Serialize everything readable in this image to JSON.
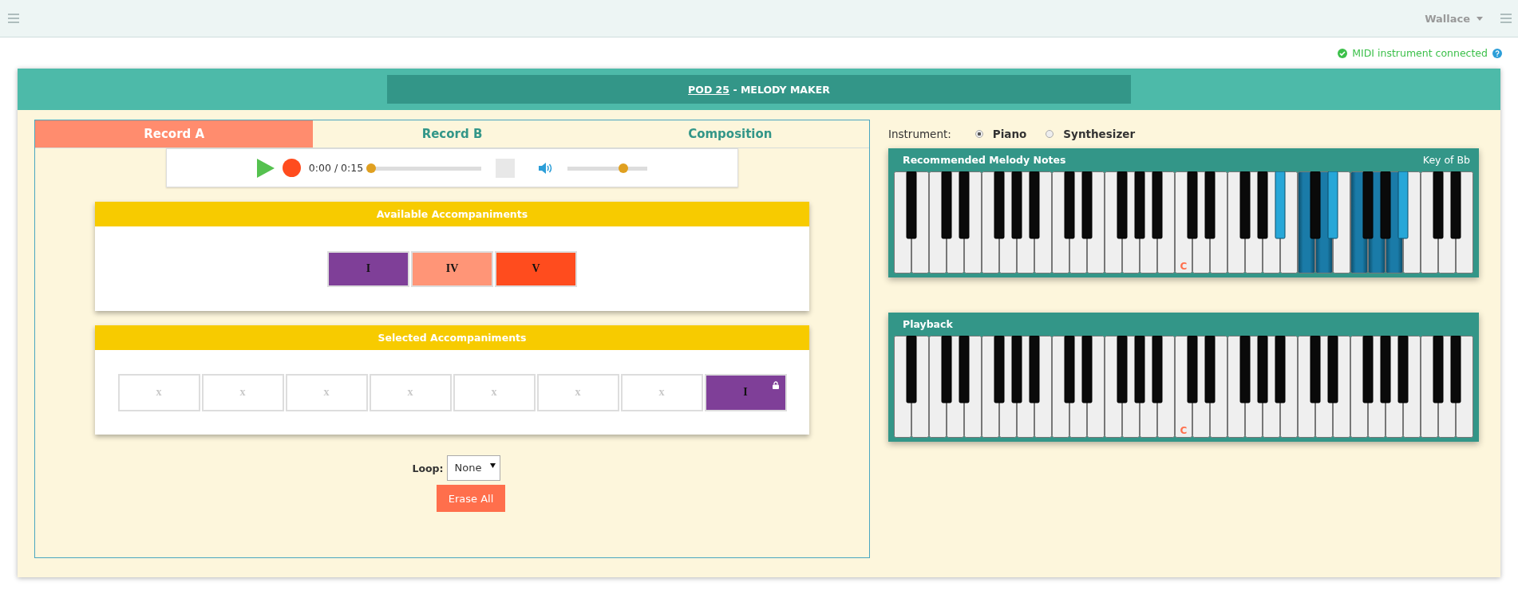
{
  "topbar": {
    "user": "Wallace"
  },
  "status": {
    "text": "MIDI instrument connected"
  },
  "header": {
    "link": "POD 25",
    "title": " - MELODY MAKER"
  },
  "tabs": [
    {
      "label": "Record A",
      "selected": true
    },
    {
      "label": "Record B",
      "selected": false
    },
    {
      "label": "Composition",
      "selected": false
    }
  ],
  "player": {
    "time": "0:00 / 0:15",
    "progress": {
      "level": 0
    },
    "volume": {
      "level": 0.72
    }
  },
  "available": {
    "title": "Available Accompaniments",
    "chords": [
      {
        "label": "I",
        "color": "#7f3f98"
      },
      {
        "label": "IV",
        "color": "#ff9577"
      },
      {
        "label": "V",
        "color": "#ff4c1e"
      }
    ]
  },
  "selected": {
    "title": "Selected Accompaniments",
    "slots": [
      {
        "kind": "empty",
        "label": "x"
      },
      {
        "kind": "empty",
        "label": "x"
      },
      {
        "kind": "empty",
        "label": "x"
      },
      {
        "kind": "empty",
        "label": "x"
      },
      {
        "kind": "empty",
        "label": "x"
      },
      {
        "kind": "empty",
        "label": "x"
      },
      {
        "kind": "empty",
        "label": "x"
      },
      {
        "kind": "chord",
        "label": "I",
        "color": "#7f3f98",
        "locked": true
      }
    ]
  },
  "loop": {
    "label": "Loop:",
    "value": "None"
  },
  "erase_button": "Erase All",
  "instrument": {
    "label": "Instrument:",
    "options": [
      {
        "label": "Piano",
        "selected": true
      },
      {
        "label": "Synthesizer",
        "selected": false
      }
    ]
  },
  "keyboards": [
    {
      "title": "Recommended Melody Notes",
      "key": "Key of Bb",
      "keys": [
        {
          "kind": "natural",
          "highlighted": false
        },
        {
          "kind": "sharp",
          "highlighted": false
        },
        {
          "kind": "natural",
          "highlighted": false
        },
        {
          "kind": "natural",
          "highlighted": false
        },
        {
          "kind": "sharp",
          "highlighted": false
        },
        {
          "kind": "natural",
          "highlighted": false
        },
        {
          "kind": "sharp",
          "highlighted": false
        },
        {
          "kind": "natural",
          "highlighted": false
        },
        {
          "kind": "natural",
          "highlighted": false
        },
        {
          "kind": "sharp",
          "highlighted": false
        },
        {
          "kind": "natural",
          "highlighted": false
        },
        {
          "kind": "sharp",
          "highlighted": false
        },
        {
          "kind": "natural",
          "highlighted": false
        },
        {
          "kind": "sharp",
          "highlighted": false
        },
        {
          "kind": "natural",
          "highlighted": false
        },
        {
          "kind": "natural",
          "highlighted": false
        },
        {
          "kind": "sharp",
          "highlighted": false
        },
        {
          "kind": "natural",
          "highlighted": false
        },
        {
          "kind": "sharp",
          "highlighted": false
        },
        {
          "kind": "natural",
          "highlighted": false
        },
        {
          "kind": "natural",
          "highlighted": false
        },
        {
          "kind": "sharp",
          "highlighted": false
        },
        {
          "kind": "natural",
          "highlighted": false
        },
        {
          "kind": "sharp",
          "highlighted": false
        },
        {
          "kind": "natural",
          "highlighted": false
        },
        {
          "kind": "sharp",
          "highlighted": false
        },
        {
          "kind": "natural",
          "highlighted": false
        },
        {
          "kind": "natural",
          "highlighted": false,
          "label": "C"
        },
        {
          "kind": "sharp",
          "highlighted": false
        },
        {
          "kind": "natural",
          "highlighted": false
        },
        {
          "kind": "sharp",
          "highlighted": false
        },
        {
          "kind": "natural",
          "highlighted": false
        },
        {
          "kind": "natural",
          "highlighted": false
        },
        {
          "kind": "sharp",
          "highlighted": false
        },
        {
          "kind": "natural",
          "highlighted": false
        },
        {
          "kind": "sharp",
          "highlighted": false
        },
        {
          "kind": "natural",
          "highlighted": false
        },
        {
          "kind": "sharp",
          "highlighted": true
        },
        {
          "kind": "natural",
          "highlighted": false
        },
        {
          "kind": "natural",
          "highlighted": true
        },
        {
          "kind": "sharp",
          "highlighted": false
        },
        {
          "kind": "natural",
          "highlighted": true
        },
        {
          "kind": "sharp",
          "highlighted": true
        },
        {
          "kind": "natural",
          "highlighted": false
        },
        {
          "kind": "natural",
          "highlighted": true
        },
        {
          "kind": "sharp",
          "highlighted": false
        },
        {
          "kind": "natural",
          "highlighted": true
        },
        {
          "kind": "sharp",
          "highlighted": false
        },
        {
          "kind": "natural",
          "highlighted": true
        },
        {
          "kind": "sharp",
          "highlighted": true
        },
        {
          "kind": "natural",
          "highlighted": false
        },
        {
          "kind": "natural",
          "highlighted": false
        },
        {
          "kind": "sharp",
          "highlighted": false
        },
        {
          "kind": "natural",
          "highlighted": false
        },
        {
          "kind": "sharp",
          "highlighted": false
        },
        {
          "kind": "natural",
          "highlighted": false
        }
      ]
    },
    {
      "title": "Playback",
      "keys": [
        {
          "kind": "natural",
          "highlighted": false
        },
        {
          "kind": "sharp",
          "highlighted": false
        },
        {
          "kind": "natural",
          "highlighted": false
        },
        {
          "kind": "natural",
          "highlighted": false
        },
        {
          "kind": "sharp",
          "highlighted": false
        },
        {
          "kind": "natural",
          "highlighted": false
        },
        {
          "kind": "sharp",
          "highlighted": false
        },
        {
          "kind": "natural",
          "highlighted": false
        },
        {
          "kind": "natural",
          "highlighted": false
        },
        {
          "kind": "sharp",
          "highlighted": false
        },
        {
          "kind": "natural",
          "highlighted": false
        },
        {
          "kind": "sharp",
          "highlighted": false
        },
        {
          "kind": "natural",
          "highlighted": false
        },
        {
          "kind": "sharp",
          "highlighted": false
        },
        {
          "kind": "natural",
          "highlighted": false
        },
        {
          "kind": "natural",
          "highlighted": false
        },
        {
          "kind": "sharp",
          "highlighted": false
        },
        {
          "kind": "natural",
          "highlighted": false
        },
        {
          "kind": "sharp",
          "highlighted": false
        },
        {
          "kind": "natural",
          "highlighted": false
        },
        {
          "kind": "natural",
          "highlighted": false
        },
        {
          "kind": "sharp",
          "highlighted": false
        },
        {
          "kind": "natural",
          "highlighted": false
        },
        {
          "kind": "sharp",
          "highlighted": false
        },
        {
          "kind": "natural",
          "highlighted": false
        },
        {
          "kind": "sharp",
          "highlighted": false
        },
        {
          "kind": "natural",
          "highlighted": false
        },
        {
          "kind": "natural",
          "highlighted": false,
          "label": "C"
        },
        {
          "kind": "sharp",
          "highlighted": false
        },
        {
          "kind": "natural",
          "highlighted": false
        },
        {
          "kind": "sharp",
          "highlighted": false
        },
        {
          "kind": "natural",
          "highlighted": false
        },
        {
          "kind": "natural",
          "highlighted": false
        },
        {
          "kind": "sharp",
          "highlighted": false
        },
        {
          "kind": "natural",
          "highlighted": false
        },
        {
          "kind": "sharp",
          "highlighted": false
        },
        {
          "kind": "natural",
          "highlighted": false
        },
        {
          "kind": "sharp",
          "highlighted": false
        },
        {
          "kind": "natural",
          "highlighted": false
        },
        {
          "kind": "natural",
          "highlighted": false
        },
        {
          "kind": "sharp",
          "highlighted": false
        },
        {
          "kind": "natural",
          "highlighted": false
        },
        {
          "kind": "sharp",
          "highlighted": false
        },
        {
          "kind": "natural",
          "highlighted": false
        },
        {
          "kind": "natural",
          "highlighted": false
        },
        {
          "kind": "sharp",
          "highlighted": false
        },
        {
          "kind": "natural",
          "highlighted": false
        },
        {
          "kind": "sharp",
          "highlighted": false
        },
        {
          "kind": "natural",
          "highlighted": false
        },
        {
          "kind": "sharp",
          "highlighted": false
        },
        {
          "kind": "natural",
          "highlighted": false
        },
        {
          "kind": "natural",
          "highlighted": false
        },
        {
          "kind": "sharp",
          "highlighted": false
        },
        {
          "kind": "natural",
          "highlighted": false
        },
        {
          "kind": "sharp",
          "highlighted": false
        },
        {
          "kind": "natural",
          "highlighted": false
        }
      ]
    }
  ]
}
